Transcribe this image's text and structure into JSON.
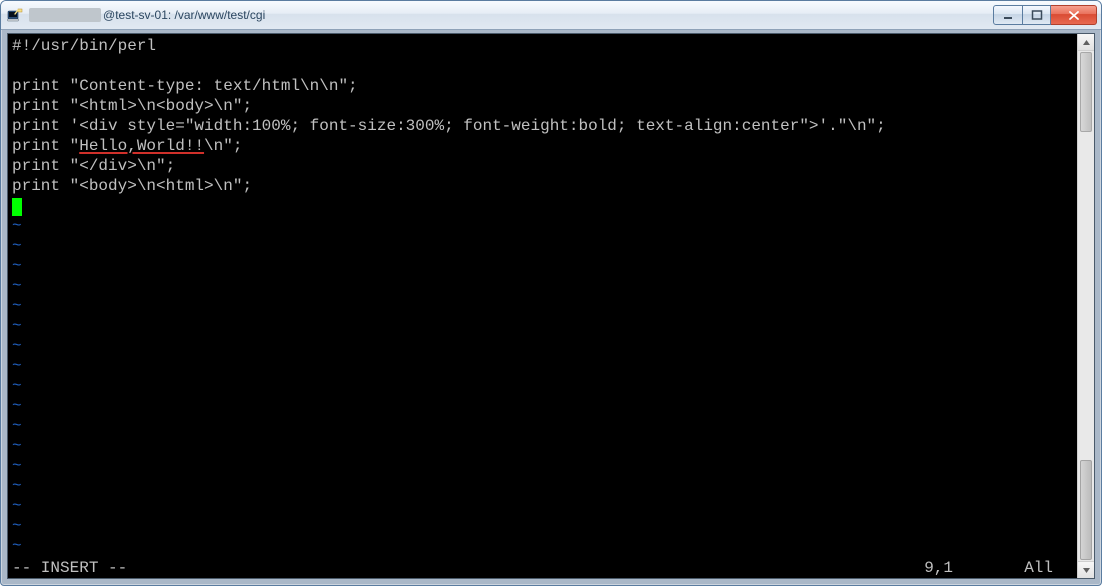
{
  "window": {
    "user_obscured": "████████",
    "title_suffix": "@test-sv-01: /var/www/test/cgi"
  },
  "editor": {
    "lines": [
      "#!/usr/bin/perl",
      "",
      "print \"Content-type: text/html\\n\\n\";",
      "print \"<html>\\n<body>\\n\";",
      "print '<div style=\"width:100%; font-size:300%; font-weight:bold; text-align:center\">'.\"\\n\";",
      "print \"Hello,World!!\\n\";",
      "print \"</div>\\n\";",
      "print \"<body>\\n<html>\\n\";"
    ],
    "underline_segment": {
      "line_index": 5,
      "text": "Hello,World!!"
    },
    "tilde_count": 17,
    "mode": "-- INSERT --",
    "cursor_pos": "9,1",
    "view": "All"
  }
}
